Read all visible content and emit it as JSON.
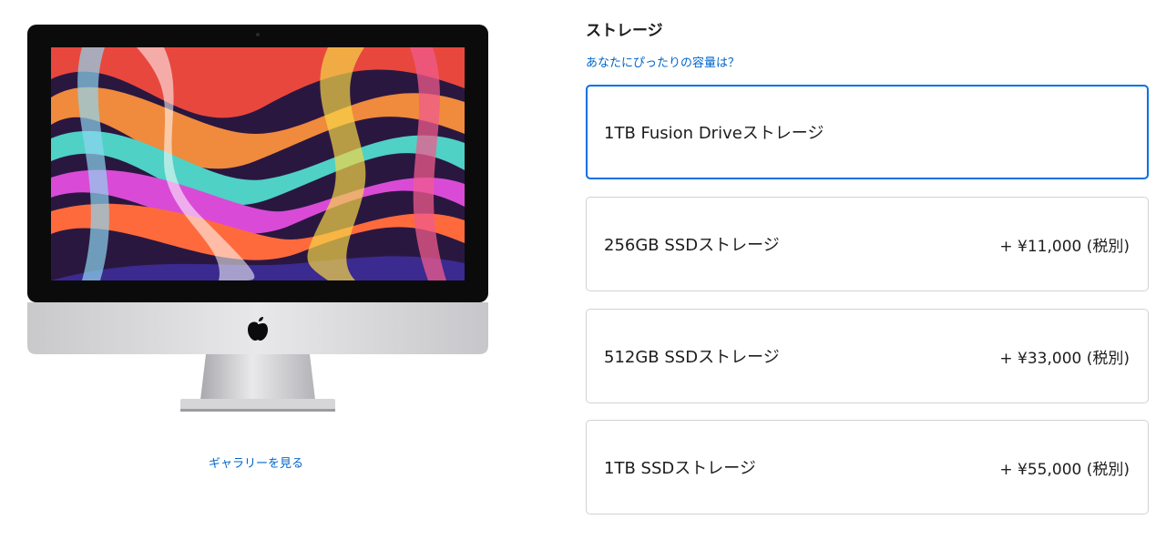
{
  "gallery": {
    "link_label": "ギャラリーを見る"
  },
  "storage": {
    "title": "ストレージ",
    "help_link": "あなたにぴったりの容量は？",
    "options": [
      {
        "label": "1TB Fusion Driveストレージ",
        "price": "",
        "selected": true
      },
      {
        "label": "256GB SSDストレージ",
        "price": "+ ¥11,000 (税別)",
        "selected": false
      },
      {
        "label": "512GB SSDストレージ",
        "price": "+ ¥33,000 (税別)",
        "selected": false
      },
      {
        "label": "1TB SSDストレージ",
        "price": "+ ¥55,000 (税別)",
        "selected": false
      }
    ]
  },
  "colors": {
    "link": "#0066cc",
    "selected_border": "#0071e3",
    "border": "#d2d2d7",
    "text": "#1d1d1f"
  },
  "icons": [
    "apple-logo-icon"
  ]
}
